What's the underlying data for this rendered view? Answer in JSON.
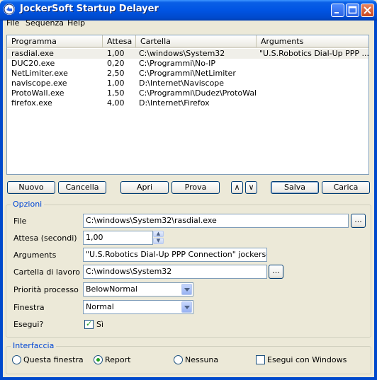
{
  "window": {
    "title": "JockerSoft Startup Delayer"
  },
  "menu": [
    {
      "label": "File"
    },
    {
      "label": "Sequenza"
    },
    {
      "label": "Help"
    }
  ],
  "list": {
    "columns": [
      "Programma",
      "Attesa",
      "Cartella",
      "Arguments"
    ],
    "rows": [
      {
        "program": "rasdial.exe",
        "wait": "1,00",
        "folder": "C:\\windows\\System32",
        "args": "\"U.S.Robotics Dial-Up PPP ..."
      },
      {
        "program": "DUC20.exe",
        "wait": "0,20",
        "folder": "C:\\Programmi\\No-IP",
        "args": ""
      },
      {
        "program": "NetLimiter.exe",
        "wait": "2,50",
        "folder": "C:\\Programmi\\NetLimiter",
        "args": ""
      },
      {
        "program": "naviscope.exe",
        "wait": "1,00",
        "folder": "D:\\Internet\\Naviscope",
        "args": ""
      },
      {
        "program": "ProtoWall.exe",
        "wait": "1,50",
        "folder": "C:\\Programmi\\Dudez\\ProtoWall",
        "args": ""
      },
      {
        "program": "firefox.exe",
        "wait": "4,00",
        "folder": "D:\\Internet\\Firefox",
        "args": ""
      }
    ]
  },
  "buttons": {
    "nuovo": "Nuovo",
    "cancella": "Cancella",
    "apri": "Apri",
    "prova": "Prova",
    "up": "∧",
    "down": "∨",
    "salva": "Salva",
    "carica": "Carica",
    "browse": "..."
  },
  "options": {
    "legend": "Opzioni",
    "file_label": "File",
    "file_value": "C:\\windows\\System32\\rasdial.exe",
    "wait_label": "Attesa (secondi)",
    "wait_value": "1,00",
    "args_label": "Arguments",
    "args_value": "\"U.S.Robotics Dial-Up PPP Connection\" jockersoft@",
    "workdir_label": "Cartella di lavoro",
    "workdir_value": "C:\\windows\\System32",
    "priority_label": "Priorità processo",
    "priority_value": "BelowNormal",
    "window_label": "Finestra",
    "window_value": "Normal",
    "run_label": "Esegui?",
    "run_check_label": "Sì",
    "run_checked": true
  },
  "interface": {
    "legend": "Interfaccia",
    "options": [
      {
        "label": "Questa finestra",
        "selected": false
      },
      {
        "label": "Report",
        "selected": true
      },
      {
        "label": "Nessuna",
        "selected": false
      }
    ],
    "startup_label": "Esegui con Windows",
    "startup_checked": false
  }
}
